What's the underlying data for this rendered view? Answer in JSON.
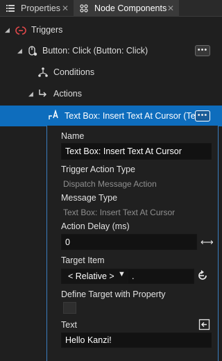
{
  "tabs": {
    "properties": "Properties",
    "node_components": "Node Components"
  },
  "tree": {
    "triggers": "Triggers",
    "button_click": "Button: Click (Button: Click)",
    "conditions": "Conditions",
    "actions": "Actions",
    "selected_action": "Text Box: Insert Text At Cursor (Text",
    "more": "•••"
  },
  "properties": {
    "name_label": "Name",
    "name_value": "Text Box: Insert Text At Cursor",
    "trigger_action_type_label": "Trigger Action Type",
    "trigger_action_type_value": "Dispatch Message Action",
    "message_type_label": "Message Type",
    "message_type_value": "Text Box: Insert Text At Cursor",
    "action_delay_label": "Action Delay (ms)",
    "action_delay_value": "0",
    "target_item_label": "Target Item",
    "target_item_relative": "< Relative >",
    "target_item_path": ".",
    "define_target_label": "Define Target with Property",
    "text_label": "Text",
    "text_value": "Hello Kanzi!"
  },
  "colors": {
    "selected_row": "#0e6dbd",
    "panel_border": "#3a7fc0",
    "trigger_icon": "#e0484a"
  }
}
